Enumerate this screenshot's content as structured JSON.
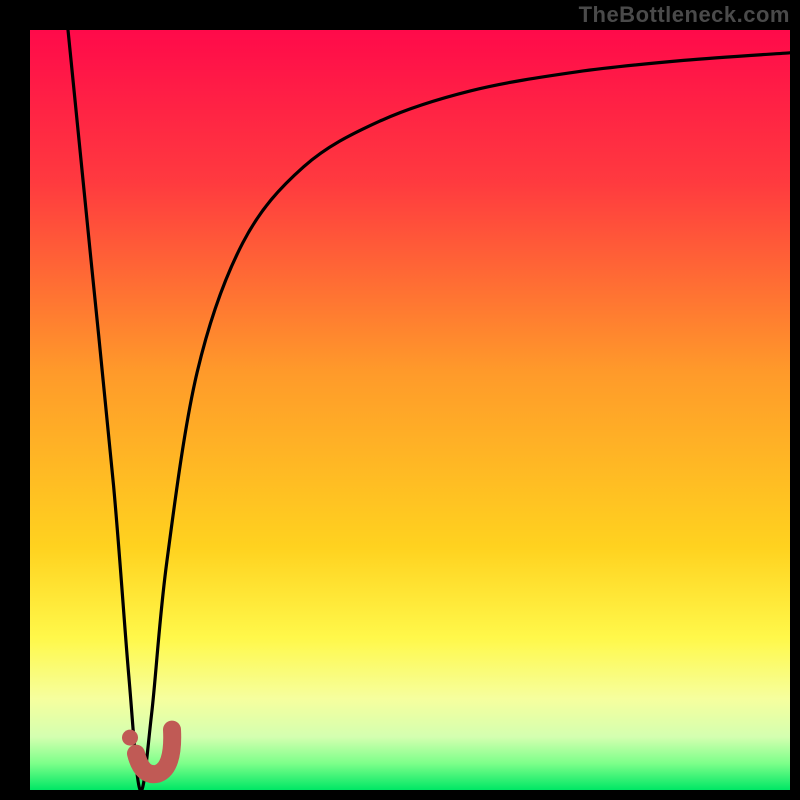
{
  "watermark": "TheBottleneck.com",
  "chart_data": {
    "type": "line",
    "title": "",
    "xlabel": "",
    "ylabel": "",
    "xlim": [
      0,
      100
    ],
    "ylim": [
      0,
      100
    ],
    "grid": false,
    "series": [
      {
        "name": "bottleneck-curve",
        "x": [
          5,
          8,
          11,
          13,
          14.5,
          16,
          18,
          22,
          28,
          36,
          46,
          58,
          72,
          86,
          100
        ],
        "y": [
          100,
          70,
          40,
          15,
          0,
          10,
          30,
          55,
          72,
          82,
          88,
          92,
          94.5,
          96,
          97
        ]
      }
    ],
    "marker": {
      "name": "selected-point-marker",
      "x_percent": 15,
      "y_percent_from_bottom": 4,
      "shape": "check",
      "color": "#c05a55",
      "dot_color": "#c05a55"
    },
    "background_gradient": {
      "stops": [
        {
          "pos": 0.0,
          "color": "#ff0a4a"
        },
        {
          "pos": 0.2,
          "color": "#ff3a3f"
        },
        {
          "pos": 0.45,
          "color": "#ff9a2a"
        },
        {
          "pos": 0.68,
          "color": "#ffd21f"
        },
        {
          "pos": 0.8,
          "color": "#fff84a"
        },
        {
          "pos": 0.88,
          "color": "#f6ff9e"
        },
        {
          "pos": 0.93,
          "color": "#d4ffb0"
        },
        {
          "pos": 0.965,
          "color": "#7dff8a"
        },
        {
          "pos": 1.0,
          "color": "#00e765"
        }
      ]
    }
  }
}
